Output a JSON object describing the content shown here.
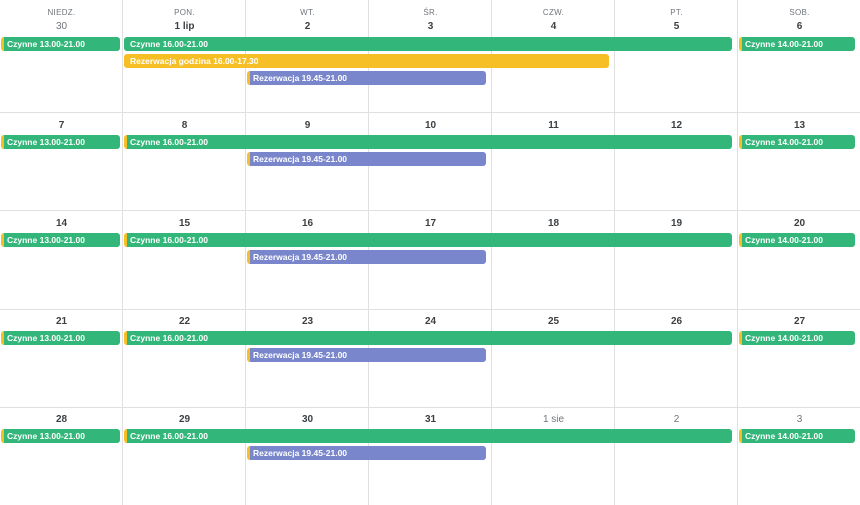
{
  "calendar": {
    "weekdays": [
      "NIEDZ.",
      "PON.",
      "WT.",
      "ŚR.",
      "CZW.",
      "PT.",
      "SOB."
    ],
    "weeks": [
      [
        "30",
        "1 lip",
        "2",
        "3",
        "4",
        "5",
        "6"
      ],
      [
        "7",
        "8",
        "9",
        "10",
        "11",
        "12",
        "13"
      ],
      [
        "14",
        "15",
        "16",
        "17",
        "18",
        "19",
        "20"
      ],
      [
        "21",
        "22",
        "23",
        "24",
        "25",
        "26",
        "27"
      ],
      [
        "28",
        "29",
        "30",
        "31",
        "1 sie",
        "2",
        "3"
      ]
    ],
    "events": {
      "sunday": "Czynne 13.00-21.00",
      "weekday": "Czynne 16.00-21.00",
      "saturday": "Czynne 14.00-21.00",
      "reservation": "Rezerwacja 19.45-21.00",
      "special": "Rezerwacja godzina 16.00-17.30"
    }
  },
  "colors": {
    "open_hours": "#33b679",
    "reservation": "#7986cb",
    "special_reservation": "#f6bf26",
    "grid": "#e0e0e0"
  }
}
